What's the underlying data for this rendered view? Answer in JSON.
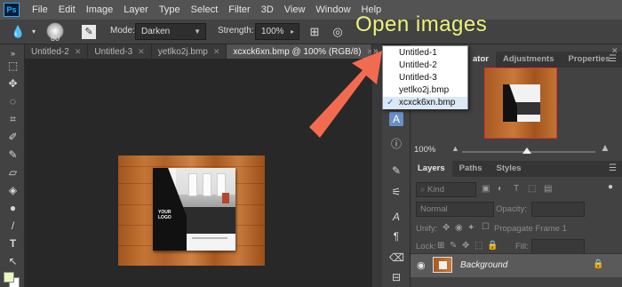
{
  "menubar": {
    "logo": "Ps",
    "items": [
      "File",
      "Edit",
      "Image",
      "Layer",
      "Type",
      "Select",
      "Filter",
      "3D",
      "View",
      "Window",
      "Help"
    ]
  },
  "options": {
    "brush_size": "80",
    "mode_label": "Mode:",
    "mode_value": "Darken",
    "strength_label": "Strength:",
    "strength_value": "100%"
  },
  "tabs": [
    {
      "label": "Untitled-2",
      "active": false
    },
    {
      "label": "Untitled-3",
      "active": false
    },
    {
      "label": "yetlko2j.bmp",
      "active": false
    },
    {
      "label": "xcxck6xn.bmp @ 100% (RGB/8)",
      "active": true
    }
  ],
  "brochure": {
    "logo_line1": "YOUR",
    "logo_line2": "LOGO"
  },
  "dropdown": {
    "items": [
      {
        "label": "Untitled-1",
        "checked": false
      },
      {
        "label": "Untitled-2",
        "checked": false
      },
      {
        "label": "Untitled-3",
        "checked": false
      },
      {
        "label": "yetlko2j.bmp",
        "checked": false
      },
      {
        "label": "xcxck6xn.bmp",
        "checked": true
      }
    ],
    "check_glyph": "✓"
  },
  "annotation": {
    "text": "Open images",
    "color": "#ecf27c",
    "arrow_color": "#f26b50"
  },
  "navigator": {
    "tabs": [
      "ator",
      "Adjustments",
      "Properties"
    ],
    "zoom": "100%"
  },
  "layers": {
    "tabs": [
      "Layers",
      "Paths",
      "Styles"
    ],
    "kind_label": "Kind",
    "blend_mode": "Normal",
    "opacity_label": "Opacity:",
    "unify_label": "Unify:",
    "propagate_label": "Propagate Frame 1",
    "lock_label": "Lock:",
    "fill_label": "Fill:",
    "layer_name": "Background"
  },
  "collapse_glyph": "»"
}
